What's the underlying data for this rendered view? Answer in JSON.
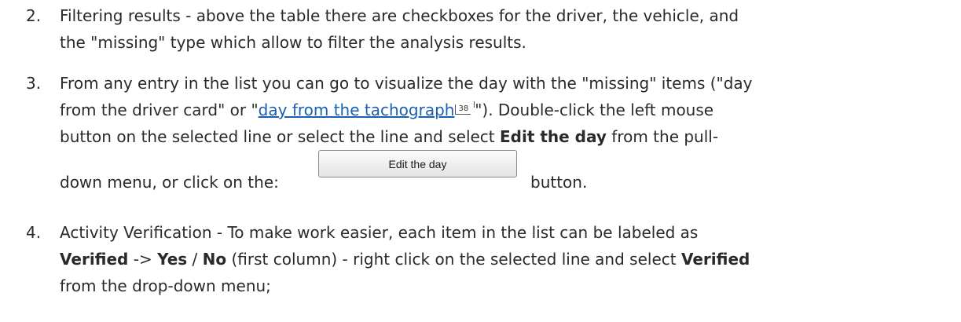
{
  "items": [
    {
      "number": "2.",
      "line1": "Filtering results - above the table there are checkboxes for the driver, the vehicle, and",
      "line2": "the \"missing\" type which allow to filter the analysis results."
    },
    {
      "number": "3.",
      "line1": "From any entry in the list you can go to visualize the day with the \"missing\" items (\"day",
      "line2_before": "from the driver card\" or \"",
      "line2_link": "day from the tachograph",
      "line2_ref": "38",
      "line2_after": "\"). Double-click the left mouse",
      "line3_before": "button on the selected line or select the line and select ",
      "line3_bold": "Edit the day",
      "line3_after": " from the pull-",
      "line4_before": "down menu, or click on the:",
      "line4_after": "button.",
      "button_label": "Edit the day"
    },
    {
      "number": "4.",
      "line1": "Activity Verification - To make work easier, each item in the list can be labeled as",
      "line2_bold1": "Verified",
      "line2_mid1": " -> ",
      "line2_bold2": "Yes",
      "line2_mid2": " / ",
      "line2_bold3": "No",
      "line2_mid3": " (first column) - right click on the selected line and select ",
      "line2_bold4": "Verified",
      "line3": "from the drop-down menu;"
    }
  ]
}
